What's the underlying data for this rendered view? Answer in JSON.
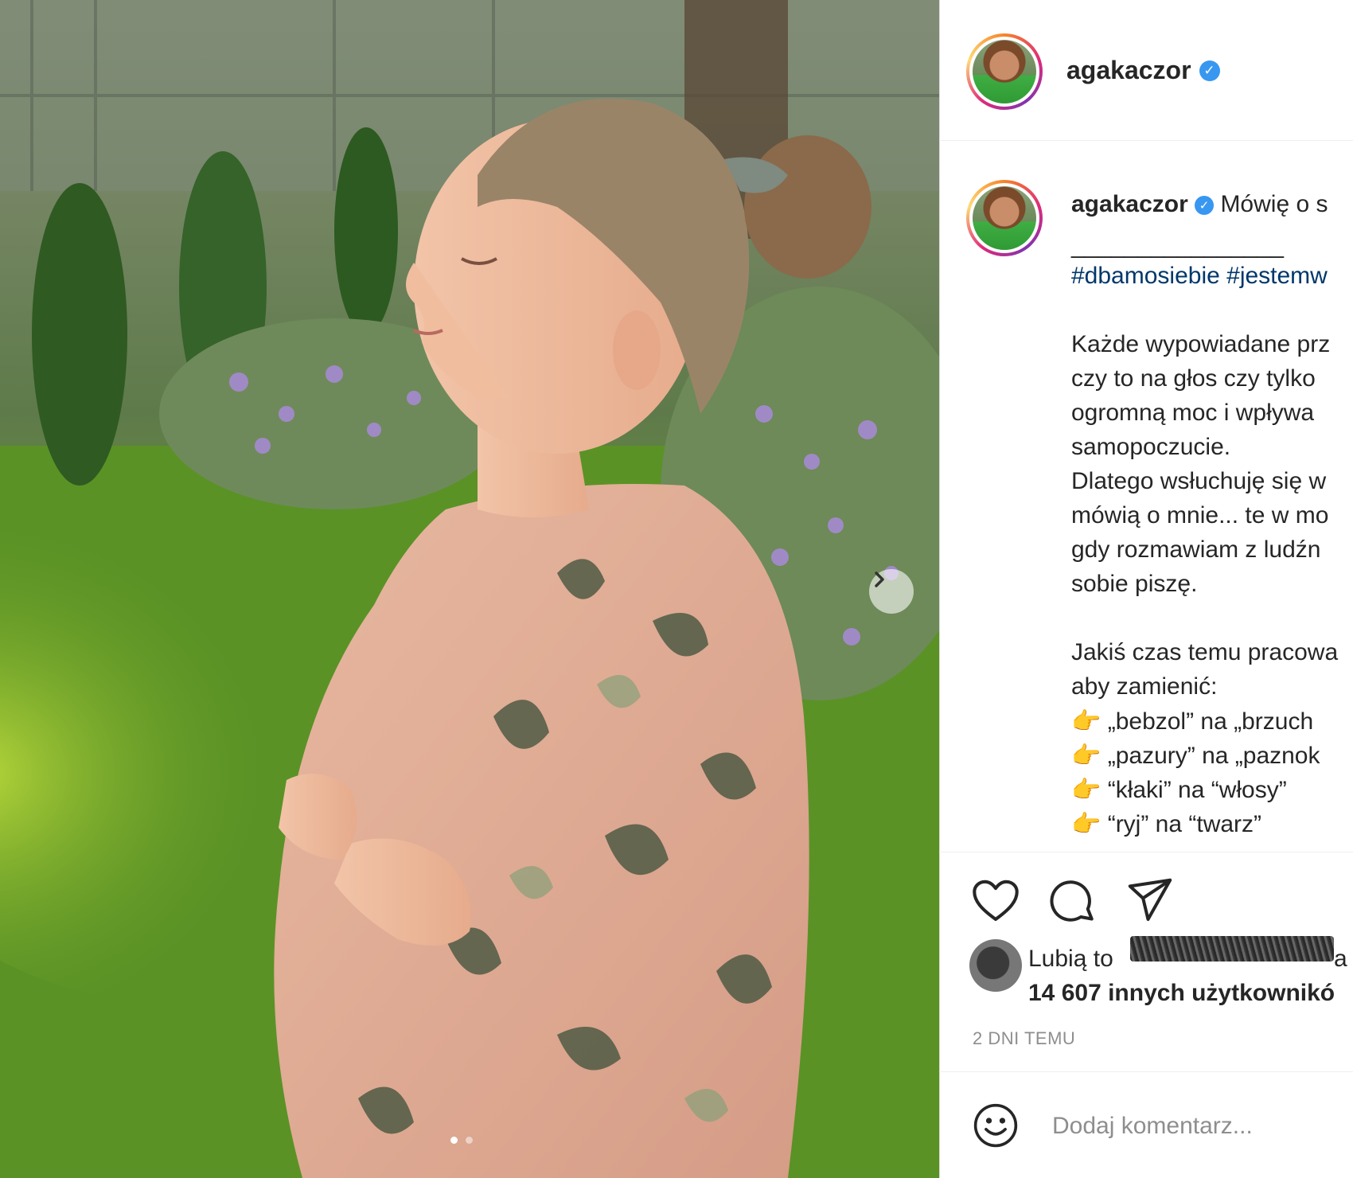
{
  "post": {
    "username": "agakaczor",
    "verified_icon": "verified-badge-icon",
    "image_alt": "Pregnant woman in floral dress standing in garden",
    "carousel": {
      "current": 1,
      "total": 2
    }
  },
  "caption": {
    "username": "agakaczor",
    "first_line": "Mówię o s",
    "separator": "________________",
    "hashtags": "#dbamosiebie #jestemw",
    "lines": [
      "Każde wypowiadane prz",
      "czy to na głos czy tylko",
      "ogromną moc i wpływa",
      "samopoczucie.",
      "Dlatego wsłuchuję się w",
      "mówią o mnie... te w mo",
      "gdy rozmawiam z ludźn",
      "sobie piszę."
    ],
    "lines2": [
      "Jakiś czas temu pracowa",
      "aby zamienić:"
    ],
    "list": [
      "„bebzol” na „brzuch",
      "„pazury” na „paznok",
      "“kłaki” na “włosy”",
      "“ryj” na “twarz”"
    ],
    "list_icon": "👉"
  },
  "actions": {
    "like_icon": "heart-icon",
    "comment_icon": "comment-icon",
    "share_icon": "share-icon"
  },
  "likes": {
    "prefix": "Lubią to",
    "suffix": "a i",
    "count_text": "14 607 innych użytkownikó"
  },
  "timestamp": "2 DNI TEMU",
  "comment": {
    "placeholder": "Dodaj komentarz...",
    "emoji_icon": "smiley-icon"
  },
  "colors": {
    "link": "#00376b",
    "verified": "#3897f0",
    "muted": "#8e8e8e"
  }
}
